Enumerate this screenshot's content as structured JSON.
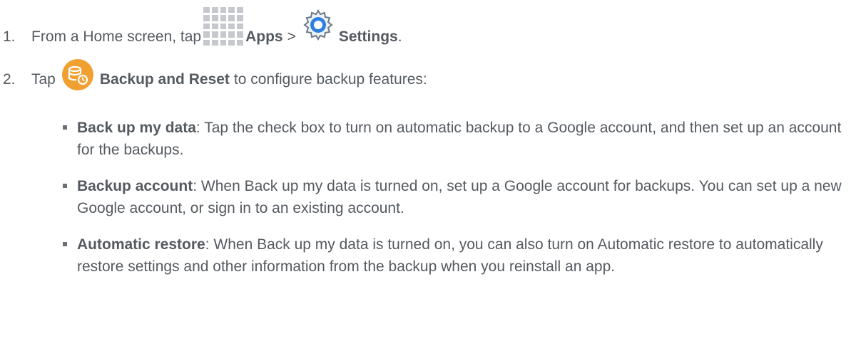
{
  "step1": {
    "number": "1.",
    "prefix": "From a Home screen, tap",
    "apps_label": "Apps",
    "separator": ">",
    "settings_label": "Settings",
    "suffix": "."
  },
  "step2": {
    "number": "2.",
    "prefix": "Tap",
    "backup_label": "Backup and Reset",
    "suffix": "to configure backup features:"
  },
  "bullets": [
    {
      "term": "Back up my data",
      "text": ": Tap the check box to turn on automatic backup to a Google account, and then set up an account for the backups."
    },
    {
      "term": "Backup account",
      "text": ": When Back up my data is turned on, set up a Google account for backups. You can set up a new Google account, or sign in to an existing account."
    },
    {
      "term": "Automatic restore",
      "text": ": When Back up my data is turned on, you can also turn on Automatic restore to automatically restore settings and other information from the backup when you reinstall an app."
    }
  ],
  "icons": {
    "apps": "apps-grid-icon",
    "settings": "settings-gear-icon",
    "backup": "backup-reset-icon"
  },
  "colors": {
    "text": "#555a60",
    "apps_grid": "#c5c8cc",
    "settings_blue": "#2f7fe0",
    "backup_orange": "#f0a030"
  }
}
